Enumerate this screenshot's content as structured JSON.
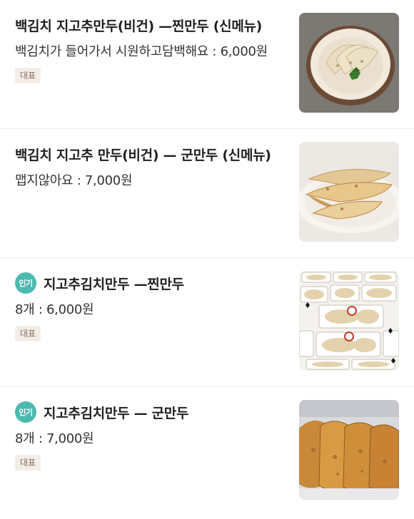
{
  "menu": {
    "items": [
      {
        "title": "백김치 지고추만두(비건) —찐만두  (신메뉴)",
        "description": "백김치가 들어가서 시원하고담백해요 : 6,000원",
        "badge": "대표",
        "popular": false,
        "photo": "steamed-dumplings-photo"
      },
      {
        "title": "백김치 지고추 만두(비건) — 군만두  (신메뉴)",
        "description": "맵지않아요 : 7,000원",
        "badge": "",
        "popular": false,
        "photo": "fried-dumplings-photo"
      },
      {
        "title": "지고추김치만두 —찐만두",
        "description": "8개 : 6,000원",
        "badge": "대표",
        "popular": true,
        "popular_label": "인기",
        "photo": "packaged-dumplings-photo"
      },
      {
        "title": "지고추김치만두 —  군만두",
        "description": "8개 : 7,000원",
        "badge": "대표",
        "popular": true,
        "popular_label": "인기",
        "photo": "pan-fried-dumplings-photo"
      }
    ]
  },
  "colors": {
    "popular_badge": "#4cb9b0",
    "rep_badge_bg": "#f3ede8",
    "rep_badge_text": "#8a6d5a"
  }
}
